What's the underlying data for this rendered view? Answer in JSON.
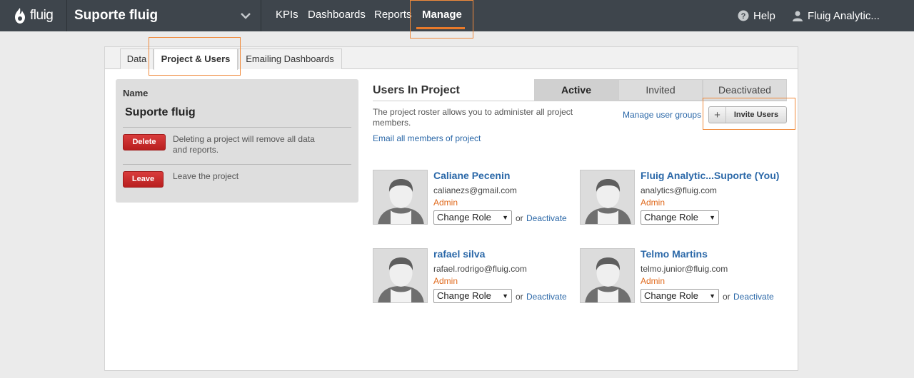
{
  "topbar": {
    "logo_text": "fluig",
    "project_name": "Suporte fluig",
    "nav": [
      "KPIs",
      "Dashboards",
      "Reports",
      "Manage"
    ],
    "help_label": "Help",
    "user_label": "Fluig Analytic...",
    "accent_color": "#e97a2a"
  },
  "tabs": [
    "Data",
    "Project & Users",
    "Emailing Dashboards"
  ],
  "project_card": {
    "name_label": "Name",
    "project_name": "Suporte fluig",
    "delete_label": "Delete",
    "delete_desc": "Deleting a project will remove all data and reports.",
    "leave_label": "Leave the project",
    "leave_button": "Leave"
  },
  "users": {
    "title": "Users In Project",
    "status_tabs": [
      "Active",
      "Invited",
      "Deactivated"
    ],
    "roster_text": "The project roster allows you to administer all project members.",
    "email_all": "Email all members of project",
    "manage_groups": "Manage user groups",
    "invite_label": "Invite Users",
    "or_text": "or",
    "change_role": "Change Role",
    "deactivate_label": "Deactivate",
    "list": [
      {
        "name": "Caliane Pecenin",
        "email": "calianezs@gmail.com",
        "role": "Admin"
      },
      {
        "name": "Fluig Analytic...Suporte (You)",
        "email": "analytics@fluig.com",
        "role": "Admin"
      },
      {
        "name": "rafael silva",
        "email": "rafael.rodrigo@fluig.com",
        "role": "Admin"
      },
      {
        "name": "Telmo Martins",
        "email": "telmo.junior@fluig.com",
        "role": "Admin"
      }
    ]
  }
}
